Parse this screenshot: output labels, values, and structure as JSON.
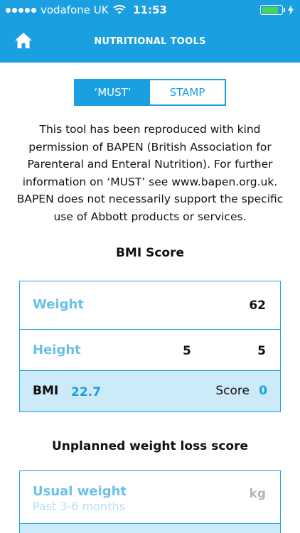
{
  "status": {
    "carrier": "vodafone UK",
    "time": "11:53",
    "battery_level": 0.85,
    "battery_color": "#47d35c"
  },
  "nav": {
    "title": "NUTRITIONAL TOOLS",
    "home_icon": "home-icon"
  },
  "tabs": {
    "items": [
      {
        "label": "‘MUST’",
        "selected": true
      },
      {
        "label": "STAMP",
        "selected": false
      }
    ]
  },
  "intro_text": "This tool has been reproduced with kind permission of BAPEN (British Association for Parenteral and Enteral Nutrition). For further information on ‘MUST’ see www.bapen.org.uk. BAPEN does not necessarily support the specific use of Abbott products or services.",
  "bmi": {
    "section_title": "BMI Score",
    "weight_label": "Weight",
    "weight_value": "62",
    "height_label": "Height",
    "height_value_1": "5",
    "height_value_2": "5",
    "bmi_label": "BMI",
    "bmi_value": "22.7",
    "score_label": "Score",
    "score_value": "0"
  },
  "weight_loss": {
    "section_title": "Unplanned weight loss score",
    "usual_weight_label": "Usual weight",
    "usual_weight_sub": "Past 3-6 months",
    "usual_weight_unit": "kg"
  },
  "colors": {
    "accent": "#1a9fe0",
    "label_blue": "#6ac0ea",
    "highlight_row": "#cceaf8"
  }
}
